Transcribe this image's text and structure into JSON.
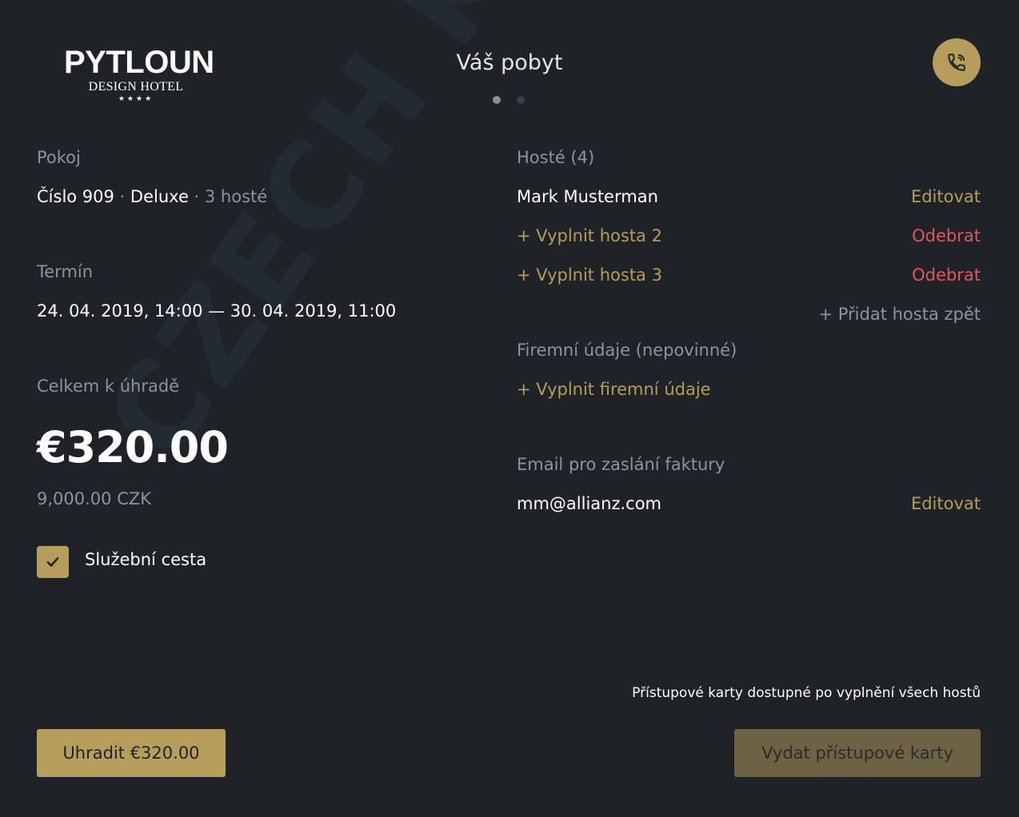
{
  "watermark": "CZECH KIOSK",
  "logo": {
    "brand": "PYTLOUN",
    "sub": "DESIGN HOTEL",
    "stars": "★★★★"
  },
  "header": {
    "title": "Váš pobyt",
    "call_icon": "phone-icon"
  },
  "room": {
    "label": "Pokoj",
    "number": "Číslo 909",
    "sep1": " · ",
    "type": "Deluxe",
    "sep2": " · ",
    "guests": "3 hosté"
  },
  "term": {
    "label": "Termín",
    "value": "24. 04. 2019, 14:00 — 30. 04. 2019, 11:00"
  },
  "total": {
    "label": "Celkem k úhradě",
    "amount": "€320.00",
    "czk": "9,000.00 CZK"
  },
  "business_trip": {
    "label": "Služební cesta",
    "checked": true
  },
  "guests": {
    "label": "Hosté (4)",
    "items": [
      {
        "name": "Mark Musterman",
        "action": "Editovat"
      },
      {
        "name": "+ Vyplnit hosta 2",
        "action": "Odebrat"
      },
      {
        "name": "+ Vyplnit hosta 3",
        "action": "Odebrat"
      }
    ],
    "add_back": "+ Přidat hosta zpět"
  },
  "company": {
    "label": "Firemní údaje (nepovinné)",
    "fill": "+ Vyplnit firemní údaje"
  },
  "invoice_email": {
    "label": "Email pro zaslání faktury",
    "value": "mm@allianz.com",
    "action": "Editovat"
  },
  "footer": {
    "note": "Přístupové karty dostupné po vyplnění všech hostů",
    "pay_button": "Uhradit €320.00",
    "cards_button": "Vydat přístupové karty"
  },
  "colors": {
    "background": "#1f2227",
    "accent": "#b59d5a",
    "danger": "#e5545a",
    "muted": "#8f949a"
  }
}
